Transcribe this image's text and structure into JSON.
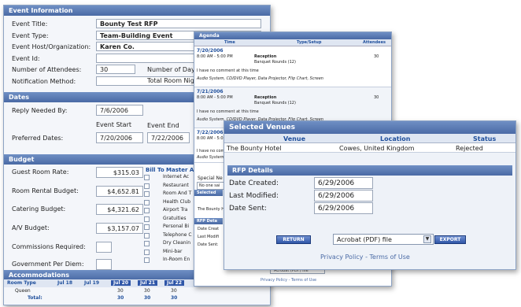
{
  "event_info": {
    "title": "Event Information",
    "fields": [
      {
        "label": "Event Title:",
        "value": "Bounty Test RFP"
      },
      {
        "label": "Event Type:",
        "value": "Team-Building Event"
      },
      {
        "label": "Event Host/Organization:",
        "value": "Karen Co."
      },
      {
        "label": "Event Id:",
        "value": ""
      },
      {
        "label": "Number of Attendees:",
        "value": "30"
      },
      {
        "label": "Notification Method:",
        "value": ""
      }
    ],
    "days_label": "Number of Days",
    "nights_label": "Total Room Nigh"
  },
  "dates": {
    "title": "Dates",
    "reply_label": "Reply Needed By:",
    "reply_value": "7/6/2006",
    "start_label": "Event Start",
    "end_label": "Event End",
    "preferred_label": "Preferred Dates:",
    "start_value": "7/20/2006",
    "end_value": "7/22/2006"
  },
  "budget": {
    "title": "Budget",
    "rows": [
      {
        "label": "Guest Room Rate:",
        "value": "$315.03"
      },
      {
        "label": "Room Rental Budget:",
        "value": "$4,652.81"
      },
      {
        "label": "Catering Budget:",
        "value": "$4,321.62"
      },
      {
        "label": "A/V Budget:",
        "value": "$3,157.07"
      },
      {
        "label": "Commissions Required:",
        "value": ""
      },
      {
        "label": "Government Per Diem:",
        "value": ""
      }
    ],
    "bill_title": "Bill To Master Ac",
    "bill_items": [
      "Internet Ac",
      "Restaurant",
      "Room And T",
      "Health Club",
      "Airport Tra",
      "Gratuities",
      "Personal Bi",
      "Telephone C",
      "Dry Cleanin",
      "Mini-bar",
      "In-Room En"
    ]
  },
  "accommodations": {
    "title": "Accommodations",
    "headers": [
      "Room Type",
      "Jul 18",
      "Jul 19",
      "Jul 20",
      "Jul 21",
      "Jul 22"
    ],
    "rows": [
      {
        "type": "Queen",
        "values": [
          "",
          "",
          "30",
          "30",
          "30"
        ]
      },
      {
        "type": "Total:",
        "values": [
          "",
          "",
          "30",
          "30",
          "30"
        ]
      }
    ]
  },
  "agenda": {
    "title": "Agenda",
    "headers": [
      "Time",
      "Type/Setup",
      "Attendees"
    ],
    "days": [
      {
        "date": "7/20/2006",
        "time": "8:00 AM - 5:00 PM",
        "type": "Reception",
        "setup": "Banquet Rounds (12)",
        "attendees": "30",
        "comment": "I have no comment at this time",
        "av": "Audio System, CD/DVD Player, Data Projector, Flip Chart, Screen"
      },
      {
        "date": "7/21/2006",
        "time": "8:00 AM - 5:00 PM",
        "type": "Reception",
        "setup": "Banquet Rounds (12)",
        "attendees": "30",
        "comment": "I have no comment at this time",
        "av": "Audio System, CD/DVD Player, Data Projector, Flip Chart, Screen"
      },
      {
        "date": "7/22/2006",
        "time": "8:00 AM - 5:00 PM",
        "type": "",
        "setup": "",
        "attendees": "",
        "comment": "I have no com",
        "av": "Audio System"
      }
    ],
    "special": "Special Ne",
    "special_value": "No one sai",
    "selected": "Selected",
    "bounty": "The Bounty Ho",
    "rfp": "RFP Deta",
    "rfp_items": [
      "Date Creat",
      "Last Modifi",
      "Date Sent:"
    ],
    "footer_links": "Privacy Policy - Terms of Use",
    "select_value": "Acrobat (PDF) file"
  },
  "venues": {
    "title": "Selected Venues",
    "headers": [
      "Venue",
      "Location",
      "Status"
    ],
    "row": {
      "venue": "The Bounty Hotel",
      "location": "Cowes, United Kingdom",
      "status": "Rejected"
    }
  },
  "rfp_details": {
    "title": "RFP Details",
    "rows": [
      {
        "label": "Date Created:",
        "value": "6/29/2006"
      },
      {
        "label": "Last Modified:",
        "value": "6/29/2006"
      },
      {
        "label": "Date Sent:",
        "value": "6/29/2006"
      }
    ]
  },
  "footer": {
    "return_label": "RETURN",
    "export_label": "EXPORT",
    "format_value": "Acrobat (PDF) file",
    "privacy": "Privacy Policy",
    "separator": " - ",
    "terms": "Terms of Use"
  }
}
